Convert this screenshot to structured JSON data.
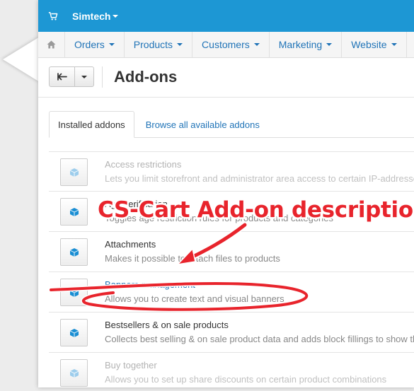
{
  "header": {
    "store_name": "Simtech"
  },
  "nav": {
    "items": [
      {
        "label": "Orders"
      },
      {
        "label": "Products"
      },
      {
        "label": "Customers"
      },
      {
        "label": "Marketing"
      },
      {
        "label": "Website"
      }
    ]
  },
  "page": {
    "title": "Add-ons"
  },
  "tabs": [
    {
      "label": "Installed addons",
      "active": true
    },
    {
      "label": "Browse all available addons",
      "active": false
    }
  ],
  "addons": [
    {
      "name": "Access restrictions",
      "description": "Lets you limit storefront and administrator area access to certain IP-addresses",
      "status": "disabled"
    },
    {
      "name": "Age verification",
      "description": "Toggles age restriction rules for products and categories",
      "status": "active"
    },
    {
      "name": "Attachments",
      "description": "Makes it possible to attach files to products",
      "status": "active"
    },
    {
      "name": "Banners management",
      "description": "Allows you to create text and visual banners",
      "status": "active"
    },
    {
      "name": "Bestsellers & on sale products",
      "description": "Collects best selling & on sale product data and adds block fillings to show them",
      "status": "active"
    },
    {
      "name": "Buy together",
      "description": "Allows you to set up share discounts on certain product combinations",
      "status": "disabled"
    }
  ],
  "annotation": {
    "text": "CS-Cart Add-on description",
    "color": "#e8242c"
  },
  "colors": {
    "topbar": "#1d97d4",
    "link": "#1f73b7",
    "icon_active": "#1a8ed3",
    "icon_disabled": "#9dcdec"
  }
}
